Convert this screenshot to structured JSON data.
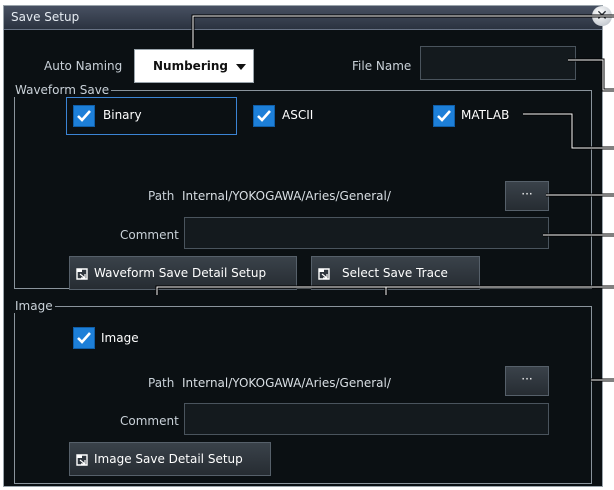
{
  "window": {
    "title": "Save Setup"
  },
  "auto_naming": {
    "label": "Auto Naming",
    "value": "Numbering"
  },
  "file_name": {
    "label": "File Name",
    "value": ""
  },
  "waveform_save": {
    "group_title": "Waveform Save",
    "checkboxes": [
      {
        "label": "Binary",
        "checked": true
      },
      {
        "label": "ASCII",
        "checked": true
      },
      {
        "label": "MATLAB",
        "checked": true
      }
    ],
    "path_label": "Path",
    "path_value": "Internal/YOKOGAWA/Aries/General/",
    "browse_label": "···",
    "comment_label": "Comment",
    "comment_value": "",
    "detail_button": "Waveform Save Detail Setup",
    "select_trace_button": "Select Save Trace"
  },
  "image": {
    "group_title": "Image",
    "checkbox": {
      "label": "Image",
      "checked": true
    },
    "path_label": "Path",
    "path_value": "Internal/YOKOGAWA/Aries/General/",
    "browse_label": "···",
    "comment_label": "Comment",
    "comment_value": "",
    "detail_button": "Image Save Detail Setup"
  },
  "colors": {
    "background": "#0b1013",
    "checkbox": "#1d7fd8",
    "selection": "#3b84d4",
    "callout_line": "#ffffff"
  }
}
